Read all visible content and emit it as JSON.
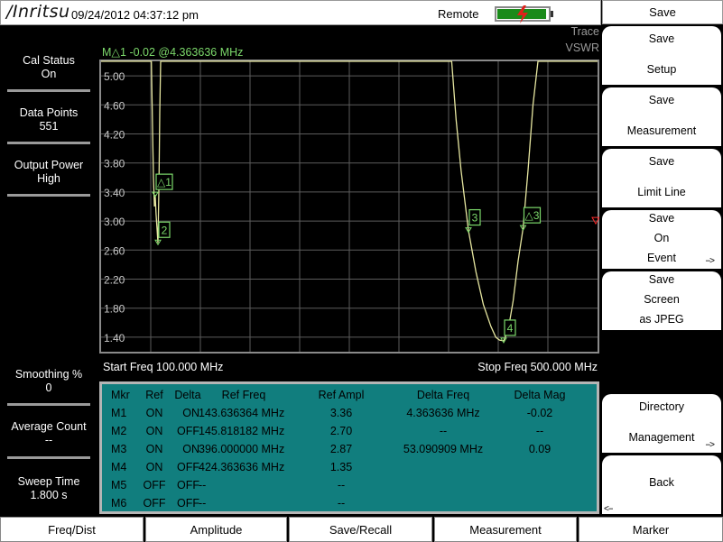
{
  "header": {
    "logo_text": "/Inritsu",
    "datetime": "09/24/2012 04:37:12 pm",
    "remote_label": "Remote",
    "battery_icon": "battery-charging-icon",
    "battery_level": 0.9
  },
  "left_panel": {
    "cal_status_label": "Cal Status",
    "cal_status_value": "On",
    "data_points_label": "Data Points",
    "data_points_value": "551",
    "output_power_label": "Output Power",
    "output_power_value": "High",
    "smoothing_label": "Smoothing %",
    "smoothing_value": "0",
    "average_count_label": "Average Count",
    "average_count_value": "--",
    "sweep_time_label": "Sweep Time",
    "sweep_time_value": "1.800 s"
  },
  "plot": {
    "marker_readout": "M△1 -0.02 @4.363636 MHz",
    "trace_label": "Trace",
    "trace_type": "VSWR",
    "start_freq": "Start Freq 100.000 MHz",
    "stop_freq": "Stop Freq 500.000 MHz",
    "trace_color": "#e6e6a0",
    "marker_color": "#7cd96b",
    "grid_color": "#5c5c5c",
    "limit_color": "#ff2a2a"
  },
  "chart_data": {
    "type": "line",
    "x_unit": "MHz",
    "xlim": [
      100,
      500
    ],
    "ylim": [
      1.2,
      5.2
    ],
    "yticks": [
      "5.00",
      "4.60",
      "4.20",
      "3.80",
      "3.40",
      "3.00",
      "2.60",
      "2.20",
      "1.80",
      "1.40"
    ],
    "ytick_values": [
      5.0,
      4.6,
      4.2,
      3.8,
      3.4,
      3.0,
      2.6,
      2.2,
      1.8,
      1.4
    ],
    "series": [
      {
        "points": [
          [
            100,
            5.2
          ],
          [
            140.5,
            5.2
          ],
          [
            141.5,
            4.2
          ],
          [
            142.2,
            3.6
          ],
          [
            143.0,
            3.2
          ],
          [
            143.6,
            3.36
          ],
          [
            144.3,
            3.1
          ],
          [
            145.8,
            2.7
          ],
          [
            146.6,
            3.5
          ],
          [
            147.3,
            4.5
          ],
          [
            148.0,
            5.2
          ],
          [
            382.5,
            5.2
          ],
          [
            386,
            4.4
          ],
          [
            390,
            3.7
          ],
          [
            396,
            2.87
          ],
          [
            402,
            2.3
          ],
          [
            408,
            1.85
          ],
          [
            414,
            1.55
          ],
          [
            418,
            1.4
          ],
          [
            421,
            1.36
          ],
          [
            424.4,
            1.35
          ],
          [
            428,
            1.5
          ],
          [
            432,
            1.9
          ],
          [
            436,
            2.45
          ],
          [
            440,
            2.9
          ],
          [
            444,
            3.7
          ],
          [
            448,
            4.6
          ],
          [
            452,
            5.2
          ],
          [
            500,
            5.2
          ]
        ]
      }
    ],
    "markers": [
      {
        "label": "△1",
        "x": 143.636364,
        "y": 3.36
      },
      {
        "label": "2",
        "x": 145.818182,
        "y": 2.7
      },
      {
        "label": "3",
        "x": 396.0,
        "y": 2.87
      },
      {
        "label": "4",
        "x": 424.363636,
        "y": 1.35
      },
      {
        "label": "△3",
        "x": 440.0,
        "y": 2.9
      }
    ],
    "limit_y": 3.0
  },
  "marker_table": {
    "headers": {
      "mkr": "Mkr",
      "ref": "Ref",
      "delta": "Delta",
      "ref_freq": "Ref Freq",
      "ref_ampl": "Ref Ampl",
      "delta_freq": "Delta Freq",
      "delta_mag": "Delta Mag"
    },
    "rows": [
      {
        "mkr": "M1",
        "ref": "ON",
        "delta": "ON",
        "ref_freq": "143.636364 MHz",
        "ref_ampl": "3.36",
        "delta_freq": "4.363636 MHz",
        "delta_mag": "-0.02"
      },
      {
        "mkr": "M2",
        "ref": "ON",
        "delta": "OFF",
        "ref_freq": "145.818182 MHz",
        "ref_ampl": "2.70",
        "delta_freq": "--",
        "delta_mag": "--"
      },
      {
        "mkr": "M3",
        "ref": "ON",
        "delta": "ON",
        "ref_freq": "396.000000 MHz",
        "ref_ampl": "2.87",
        "delta_freq": "53.090909 MHz",
        "delta_mag": "0.09"
      },
      {
        "mkr": "M4",
        "ref": "ON",
        "delta": "OFF",
        "ref_freq": "424.363636 MHz",
        "ref_ampl": "1.35",
        "delta_freq": "",
        "delta_mag": ""
      },
      {
        "mkr": "M5",
        "ref": "OFF",
        "delta": "OFF",
        "ref_freq": "--",
        "ref_ampl": "--",
        "delta_freq": "",
        "delta_mag": ""
      },
      {
        "mkr": "M6",
        "ref": "OFF",
        "delta": "OFF",
        "ref_freq": "--",
        "ref_ampl": "--",
        "delta_freq": "",
        "delta_mag": ""
      }
    ]
  },
  "right_menu": {
    "title": "Save",
    "save_setup": {
      "line1": "Save",
      "line2": "Setup"
    },
    "save_measurement": {
      "line1": "Save",
      "line2": "Measurement"
    },
    "save_limit_line": {
      "line1": "Save",
      "line2": "Limit Line"
    },
    "save_on_event": {
      "line1": "Save",
      "line2": "On",
      "line3": "Event",
      "more": "-->"
    },
    "save_screen": {
      "line1": "Save",
      "line2": "Screen",
      "line3": "as JPEG"
    },
    "directory_management": {
      "line1": "Directory",
      "line2": "Management",
      "more": "-->"
    },
    "back": {
      "label": "Back",
      "more": "<--"
    }
  },
  "bottom_menu": {
    "freq_dist": "Freq/Dist",
    "amplitude": "Amplitude",
    "save_recall": "Save/Recall",
    "measurement": "Measurement",
    "marker": "Marker"
  }
}
